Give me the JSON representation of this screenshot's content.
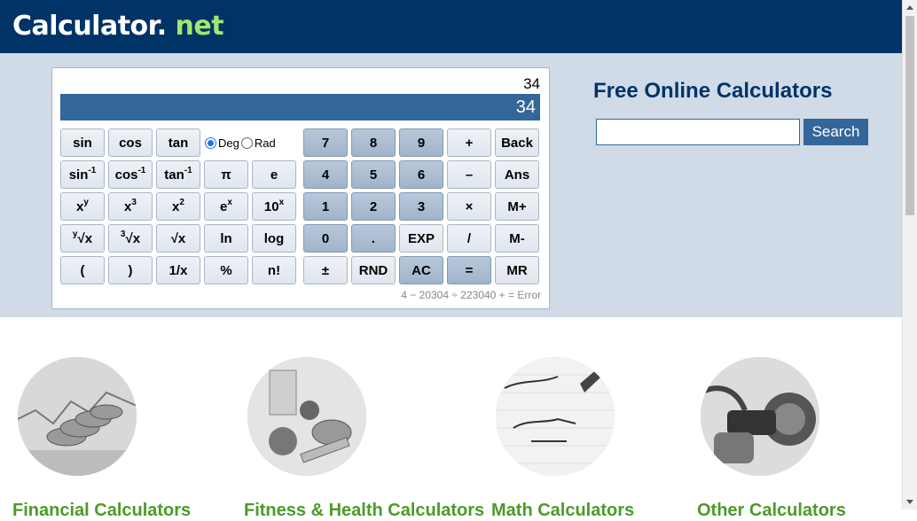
{
  "header": {
    "logo_main": "Calculator",
    "logo_dot": ".",
    "logo_tld": " net"
  },
  "calculator": {
    "previous": "34",
    "display": "34",
    "history": "4 − 20304 ÷ 223040 + = Error",
    "angle": {
      "deg_label": "Deg",
      "rad_label": "Rad",
      "selected": "Deg"
    },
    "keys": {
      "sin": "sin",
      "cos": "cos",
      "tan": "tan",
      "sin_inv_base": "sin",
      "cos_inv_base": "cos",
      "tan_inv_base": "tan",
      "inv_sup": "-1",
      "pi": "π",
      "e": "e",
      "xy_base": "x",
      "xy_sup": "y",
      "x3_base": "x",
      "x3_sup": "3",
      "x2_base": "x",
      "x2_sup": "2",
      "ex_base": "e",
      "ex_sup": "x",
      "tenx_base": "10",
      "tenx_sup": "x",
      "yroot_pre": "y",
      "yroot_main": "√x",
      "croot_pre": "3",
      "croot_main": "√x",
      "sqrt": "√x",
      "ln": "ln",
      "log": "log",
      "lparen": "(",
      "rparen": ")",
      "recip": "1/x",
      "percent": "%",
      "fact": "n!",
      "n7": "7",
      "n8": "8",
      "n9": "9",
      "plus": "+",
      "back": "Back",
      "n4": "4",
      "n5": "5",
      "n6": "6",
      "minus": "–",
      "ans": "Ans",
      "n1": "1",
      "n2": "2",
      "n3": "3",
      "times": "×",
      "mplus": "M+",
      "n0": "0",
      "dot": ".",
      "exp": "EXP",
      "divide": "/",
      "mminus": "M-",
      "plusminus": "±",
      "rnd": "RND",
      "ac": "AC",
      "equals": "=",
      "mr": "MR"
    }
  },
  "sidebar": {
    "title": "Free Online Calculators",
    "search_button": "Search",
    "search_value": ""
  },
  "categories": [
    {
      "title": "Financial Calculators"
    },
    {
      "title": "Fitness & Health Calculators"
    },
    {
      "title": "Math Calculators"
    },
    {
      "title": "Other Calculators"
    }
  ]
}
